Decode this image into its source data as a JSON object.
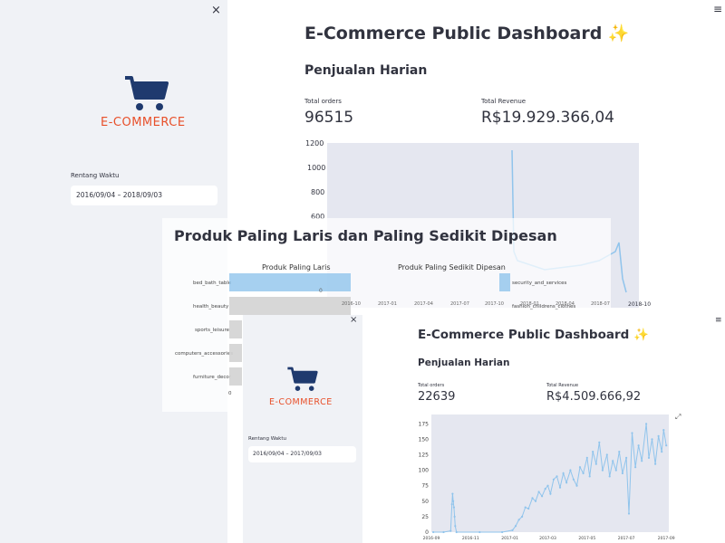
{
  "shot1": {
    "sidebar": {
      "close_glyph": "×",
      "logo_text": "E-COMMERCE",
      "range_label": "Rentang Waktu",
      "range_value": "2016/09/04 – 2018/09/03"
    },
    "main": {
      "menu_glyph": "≡",
      "title": "E-Commerce Public Dashboard ✨",
      "subtitle": "Penjualan Harian",
      "metrics": [
        {
          "label": "Total orders",
          "value": "96515"
        },
        {
          "label": "Total Revenue",
          "value": "R$19.929.366,04"
        }
      ]
    },
    "chart_data": {
      "type": "line",
      "y_ticks": [
        "1200",
        "1000",
        "800",
        "600"
      ],
      "x_tick_last": "2018-10",
      "color": "#90c4ec"
    }
  },
  "shot2": {
    "title": "Produk Paling Laris dan Paling Sedikit Dipesan",
    "chart_data": [
      {
        "type": "bar",
        "title": "Produk Paling Laris",
        "categories": [
          "bed_bath_table",
          "health_beauty",
          "sports_leisure",
          "computers_accessories",
          "furniture_decor"
        ],
        "x_tick_first": "0"
      },
      {
        "type": "bar",
        "title": "Produk Paling Sedikit Dipesan",
        "categories": [
          "security_and_services",
          "fashion_childrens_clothes"
        ]
      }
    ],
    "under_chart": {
      "x_ticks": [
        "0",
        "2016-10",
        "2017-01",
        "2017-04",
        "2017-07",
        "2017-10",
        "2018-01",
        "2018-04",
        "2018-07"
      ]
    }
  },
  "shot3": {
    "sidebar": {
      "close_glyph": "×",
      "logo_text": "E-COMMERCE",
      "range_label": "Rentang Waktu",
      "range_value": "2016/09/04 – 2017/09/03"
    },
    "main": {
      "menu_glyph": "≡",
      "expand_glyph": "⤢",
      "title": "E-Commerce Public Dashboard ✨",
      "subtitle": "Penjualan Harian",
      "metrics": [
        {
          "label": "Total orders",
          "value": "22639"
        },
        {
          "label": "Total Revenue",
          "value": "R$4.509.666,92"
        }
      ]
    },
    "chart_data": {
      "type": "line",
      "color": "#90c4ec",
      "x_tick_labels": [
        "2016-09",
        "2016-11",
        "2017-01",
        "2017-03",
        "2017-05",
        "2017-07",
        "2017-09"
      ],
      "y_ticks": [
        0,
        25,
        50,
        75,
        100,
        125,
        150,
        175
      ],
      "ylim": [
        0,
        190
      ],
      "xlim": [
        "2016-09-01",
        "2017-09-05"
      ],
      "points": [
        [
          "2016-09-04",
          0
        ],
        [
          "2016-09-20",
          0
        ],
        [
          "2016-10-01",
          2
        ],
        [
          "2016-10-03",
          45
        ],
        [
          "2016-10-04",
          62
        ],
        [
          "2016-10-05",
          50
        ],
        [
          "2016-10-06",
          40
        ],
        [
          "2016-10-07",
          25
        ],
        [
          "2016-10-08",
          10
        ],
        [
          "2016-10-10",
          0
        ],
        [
          "2016-11-15",
          0
        ],
        [
          "2016-12-20",
          0
        ],
        [
          "2017-01-05",
          3
        ],
        [
          "2017-01-10",
          10
        ],
        [
          "2017-01-15",
          20
        ],
        [
          "2017-01-20",
          25
        ],
        [
          "2017-01-25",
          40
        ],
        [
          "2017-01-30",
          38
        ],
        [
          "2017-02-05",
          55
        ],
        [
          "2017-02-10",
          50
        ],
        [
          "2017-02-15",
          65
        ],
        [
          "2017-02-20",
          58
        ],
        [
          "2017-02-25",
          70
        ],
        [
          "2017-03-01",
          75
        ],
        [
          "2017-03-05",
          62
        ],
        [
          "2017-03-10",
          85
        ],
        [
          "2017-03-15",
          90
        ],
        [
          "2017-03-20",
          72
        ],
        [
          "2017-03-25",
          95
        ],
        [
          "2017-03-30",
          80
        ],
        [
          "2017-04-05",
          100
        ],
        [
          "2017-04-10",
          85
        ],
        [
          "2017-04-15",
          75
        ],
        [
          "2017-04-20",
          105
        ],
        [
          "2017-04-25",
          95
        ],
        [
          "2017-05-01",
          120
        ],
        [
          "2017-05-05",
          90
        ],
        [
          "2017-05-10",
          130
        ],
        [
          "2017-05-15",
          110
        ],
        [
          "2017-05-20",
          145
        ],
        [
          "2017-05-25",
          100
        ],
        [
          "2017-06-01",
          125
        ],
        [
          "2017-06-05",
          90
        ],
        [
          "2017-06-10",
          115
        ],
        [
          "2017-06-15",
          100
        ],
        [
          "2017-06-20",
          130
        ],
        [
          "2017-06-25",
          95
        ],
        [
          "2017-07-01",
          120
        ],
        [
          "2017-07-05",
          30
        ],
        [
          "2017-07-10",
          160
        ],
        [
          "2017-07-15",
          105
        ],
        [
          "2017-07-20",
          140
        ],
        [
          "2017-07-25",
          115
        ],
        [
          "2017-08-01",
          175
        ],
        [
          "2017-08-05",
          120
        ],
        [
          "2017-08-10",
          150
        ],
        [
          "2017-08-15",
          110
        ],
        [
          "2017-08-20",
          155
        ],
        [
          "2017-08-25",
          130
        ],
        [
          "2017-08-28",
          165
        ],
        [
          "2017-09-01",
          140
        ]
      ]
    }
  }
}
